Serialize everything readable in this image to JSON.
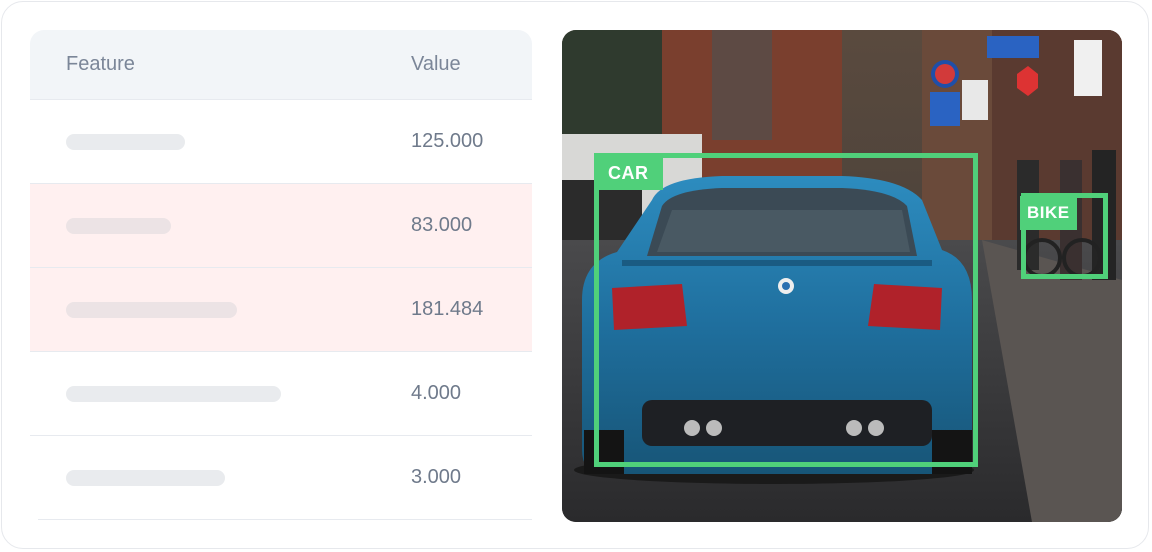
{
  "table": {
    "header": {
      "feature": "Feature",
      "value": "Value"
    },
    "rows": [
      {
        "value": "125.000",
        "highlighted": false
      },
      {
        "value": "83.000",
        "highlighted": true
      },
      {
        "value": "181.484",
        "highlighted": true
      },
      {
        "value": "4.000",
        "highlighted": false
      },
      {
        "value": "3.000",
        "highlighted": false
      }
    ]
  },
  "detections": {
    "car": {
      "label": "CAR"
    },
    "bike": {
      "label": "BIKE"
    }
  },
  "colors": {
    "box": "#50d07a",
    "highlight_row": "#fff0f0",
    "header_bg": "#f2f5f8"
  }
}
